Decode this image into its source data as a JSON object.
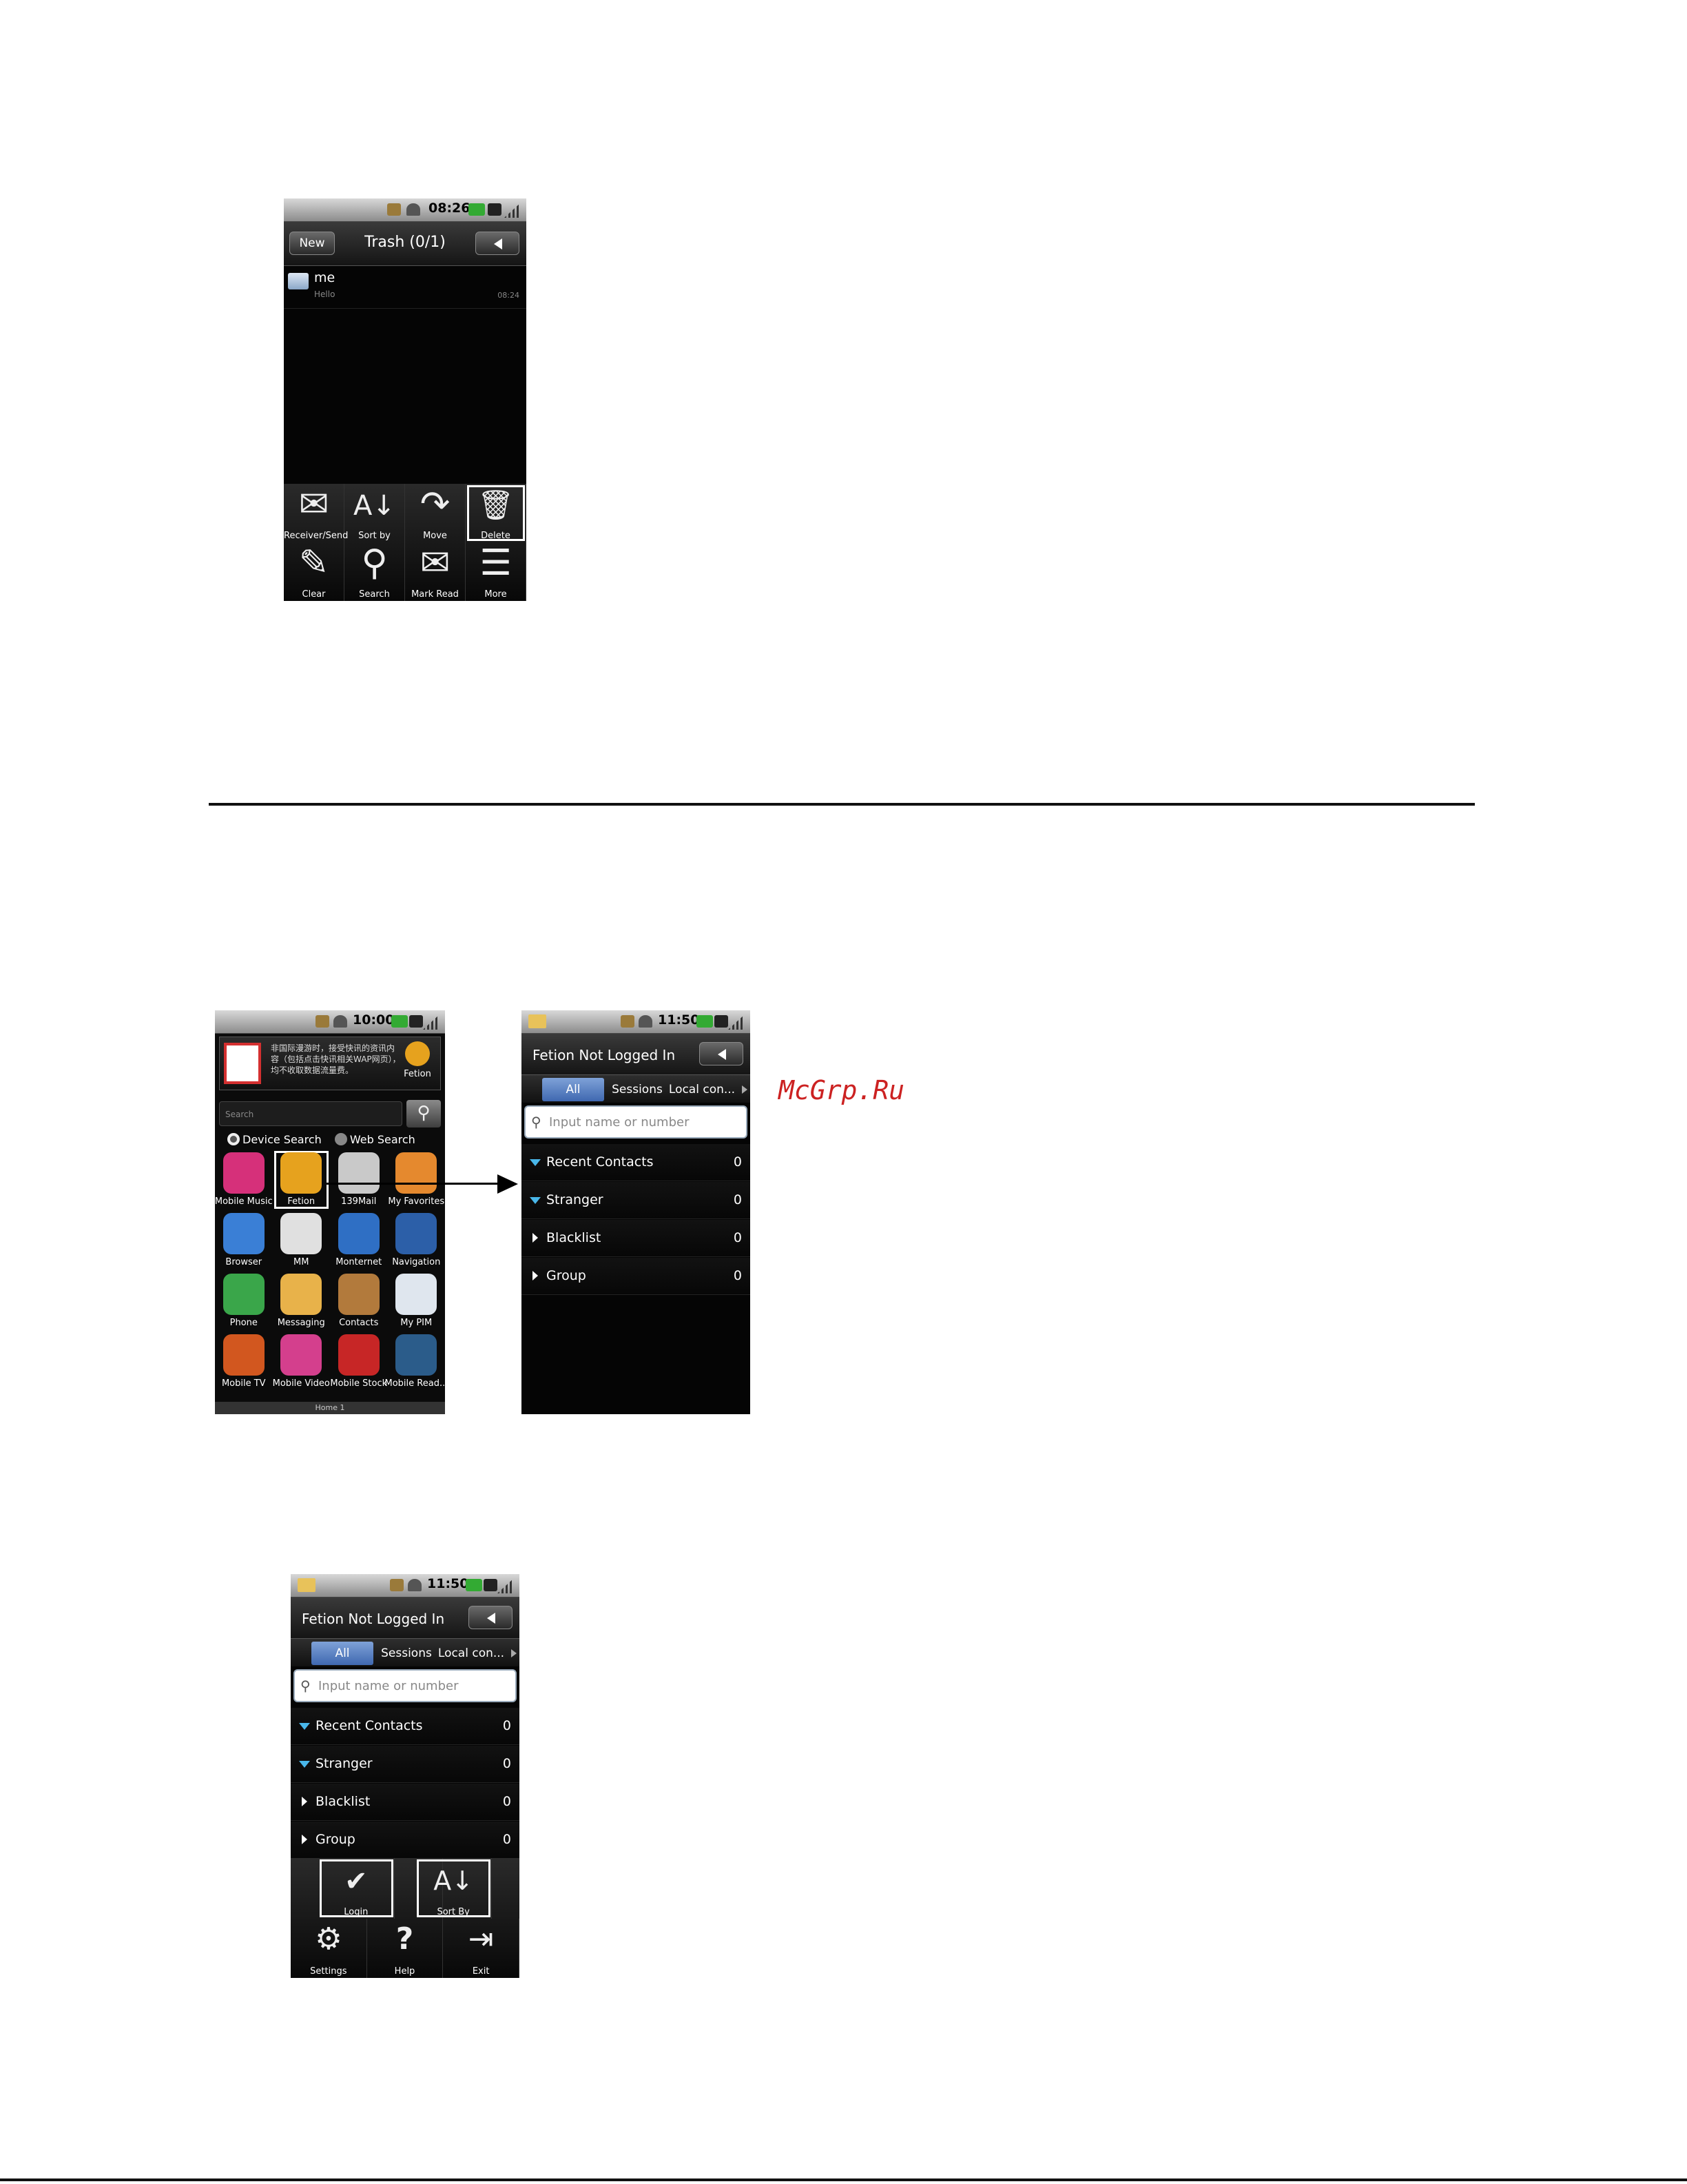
{
  "trash_screen": {
    "status_time": "08:26",
    "new_button": "New",
    "title": "Trash (0/1)",
    "message": {
      "sender": "me",
      "preview": "Hello",
      "time": "08:24"
    },
    "menu": [
      {
        "label": "Receiver/Send",
        "icon": "envelopes-icon",
        "glyph": "✉"
      },
      {
        "label": "Sort by",
        "icon": "sort-icon",
        "glyph": "A↓"
      },
      {
        "label": "Move",
        "icon": "move-icon",
        "glyph": "↷"
      },
      {
        "label": "Delete",
        "icon": "trash-icon",
        "glyph": "🗑"
      },
      {
        "label": "Clear",
        "icon": "broom-icon",
        "glyph": "✎"
      },
      {
        "label": "Search",
        "icon": "magnifier-icon",
        "glyph": "⚲"
      },
      {
        "label": "Mark Read",
        "icon": "envelope-icon",
        "glyph": "✉"
      },
      {
        "label": "More",
        "icon": "more-icon",
        "glyph": "☰"
      }
    ]
  },
  "home_screen": {
    "status_time": "10:00",
    "banner_text": "非国际漫游时，接受快讯的资讯内容（包括点击快讯相关WAP网页），均不收取数据流量费。",
    "fetion_label": "Fetion",
    "search_placeholder": "Search",
    "device_search": "Device Search",
    "web_search": "Web Search",
    "apps": [
      {
        "label": "Mobile Music",
        "color": "#d6307a"
      },
      {
        "label": "Fetion",
        "color": "#e6a21e"
      },
      {
        "label": "139Mail",
        "color": "#c9c9c9"
      },
      {
        "label": "My Favorites",
        "color": "#e5892e"
      },
      {
        "label": "Browser",
        "color": "#3a7fd6"
      },
      {
        "label": "MM",
        "color": "#e0e0e0"
      },
      {
        "label": "Monternet",
        "color": "#2f6fc4"
      },
      {
        "label": "Navigation",
        "color": "#2c5fa8"
      },
      {
        "label": "Phone",
        "color": "#3aa64a"
      },
      {
        "label": "Messaging",
        "color": "#e8b24a"
      },
      {
        "label": "Contacts",
        "color": "#b27a3c"
      },
      {
        "label": "My PIM",
        "color": "#dfe6ee"
      },
      {
        "label": "Mobile TV",
        "color": "#d2571f"
      },
      {
        "label": "Mobile Video",
        "color": "#d43f8d"
      },
      {
        "label": "Mobile Stock",
        "color": "#c72626"
      },
      {
        "label": "Mobile Read...",
        "color": "#2b5c8a"
      }
    ],
    "home_indicator": "Home 1"
  },
  "fetion_screen": {
    "status_time": "11:50",
    "title": "Fetion Not Logged In",
    "tabs": [
      "All",
      "Sessions",
      "Local con..."
    ],
    "input_placeholder": "Input name or number",
    "groups": [
      {
        "label": "Recent Contacts",
        "count": "0",
        "expanded": true
      },
      {
        "label": "Stranger",
        "count": "0",
        "expanded": true
      },
      {
        "label": "Blacklist",
        "count": "0",
        "expanded": false
      },
      {
        "label": "Group",
        "count": "0",
        "expanded": false
      }
    ]
  },
  "fetion_menu_screen": {
    "status_time": "11:50",
    "title": "Fetion Not Logged In",
    "tabs": [
      "All",
      "Sessions",
      "Local con..."
    ],
    "input_placeholder": "Input name or number",
    "groups": [
      {
        "label": "Recent Contacts",
        "count": "0",
        "expanded": true
      },
      {
        "label": "Stranger",
        "count": "0",
        "expanded": true
      },
      {
        "label": "Blacklist",
        "count": "0",
        "expanded": false
      },
      {
        "label": "Group",
        "count": "0",
        "expanded": false
      }
    ],
    "menu": [
      {
        "label": "Login",
        "icon": "check-icon",
        "glyph": "✔"
      },
      {
        "label": "Sort By",
        "icon": "sort-icon",
        "glyph": "A↓"
      },
      {
        "label": "Settings",
        "icon": "gear-icon",
        "glyph": "⚙"
      },
      {
        "label": "Help",
        "icon": "help-icon",
        "glyph": "?"
      },
      {
        "label": "Exit",
        "icon": "exit-icon",
        "glyph": "⇥"
      }
    ]
  },
  "watermark": "McGrp.Ru"
}
